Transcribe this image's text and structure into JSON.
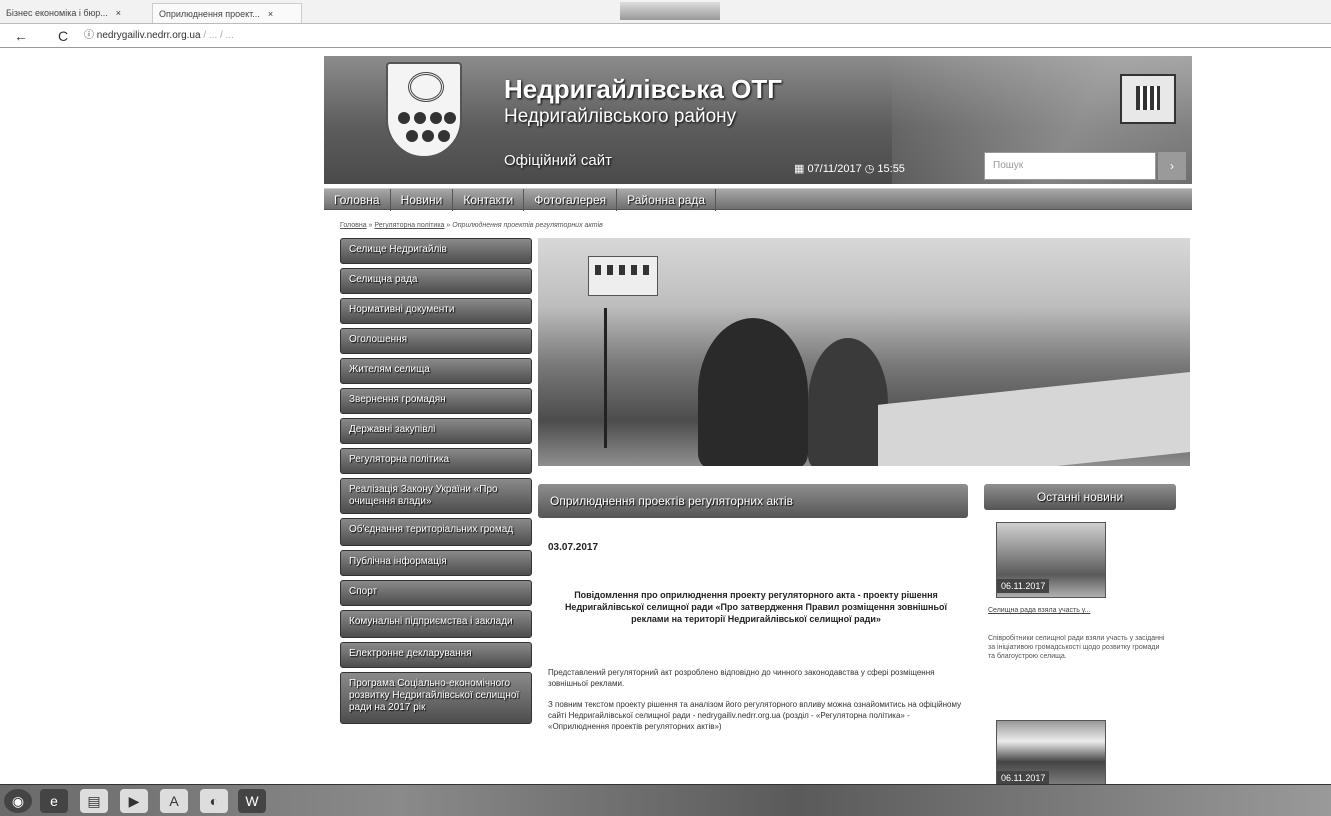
{
  "browser": {
    "tabs": [
      {
        "label": "Бізнес економіка і бюр...",
        "close": "×"
      },
      {
        "label": "Оприлюднення проект...",
        "close": "×"
      }
    ],
    "back_icon": "←",
    "reload_icon": "C",
    "url_host": "nedrygailiv.nedrr.org.ua",
    "url_path": " / ... / ..."
  },
  "header": {
    "title": "Недригайлівська ОТГ",
    "subtitle": "Недригайлівського району",
    "official": "Офіційний сайт",
    "datetime": "▦ 07/11/2017   ◷ 15:55",
    "search_placeholder": "Пошук",
    "search_button": "›"
  },
  "topnav": [
    "Головна",
    "Новини",
    "Контакти",
    "Фотогалерея",
    "Районна рада"
  ],
  "breadcrumb": {
    "home": "Головна",
    "section": "Регуляторна політика",
    "current": "Оприлюднення проектів регуляторних актів"
  },
  "sidebar": [
    "Селище Недригайлів",
    "Селищна рада",
    "Нормативні документи",
    "Оголошення",
    "Жителям селища",
    "Звернення громадян",
    "Державні закупівлі",
    "Регуляторна політика",
    "Реалізація Закону України «Про очищення влади»",
    "Об'єднання територіальних громад",
    "Публічна інформація",
    "Спорт",
    "Комунальні підприємства і заклади",
    "Електронне декларування",
    "Програма Соціально-економічного розвитку Недригайлівської селищної ради на 2017 рік"
  ],
  "article": {
    "header": "Оприлюднення проектів регуляторних актів",
    "date": "03.07.2017",
    "title": "Повідомлення про оприлюднення проекту регуляторного акта - проекту рішення Недригайлівської селищної ради «Про затвердження Правил розміщення зовнішньої реклами на території Недригайлівської селищної ради»",
    "p1": "Представлений регуляторний акт розроблено відповідно до чинного законодавства у сфері розміщення зовнішньої реклами.",
    "p2": "З повним текстом проекту рішення та аналізом його регуляторного впливу можна ознайомитись на офіційному сайті Недригайлівської селищної ради - nedrygailiv.nedrr.org.ua (розділ - «Регуляторна політика» - «Оприлюднення проектів регуляторних актів»)"
  },
  "news": {
    "header": "Останні новини",
    "item1_date": "06.11.2017",
    "item1_link": "Селищна рада взяла участь у...",
    "item1_text": "Співробітники селищної ради взяли участь у засіданні за ініціативою громадськості щодо розвитку громади та благоустрою селища.",
    "item2_date": "06.11.2017"
  },
  "taskbar": [
    "start",
    "ie",
    "explorer",
    "media",
    "acrobat",
    "app",
    "word"
  ]
}
